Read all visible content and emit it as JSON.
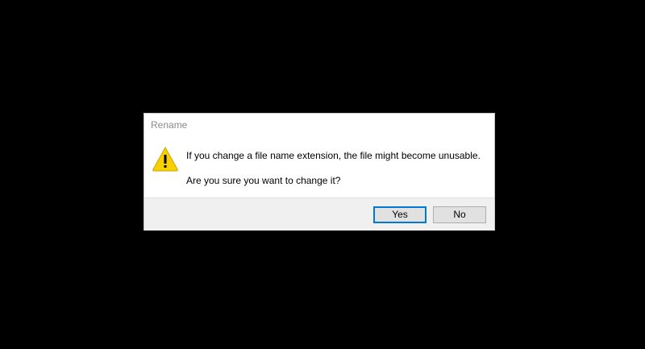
{
  "dialog": {
    "title": "Rename",
    "icon": "warning-icon",
    "message_primary": "If you change a file name extension, the file might become unusable.",
    "message_secondary": "Are you sure you want to change it?",
    "buttons": {
      "yes_label": "Yes",
      "no_label": "No"
    },
    "colors": {
      "accent": "#0078d7",
      "warning": "#f8d000",
      "footer_bg": "#f0f0f0"
    }
  }
}
